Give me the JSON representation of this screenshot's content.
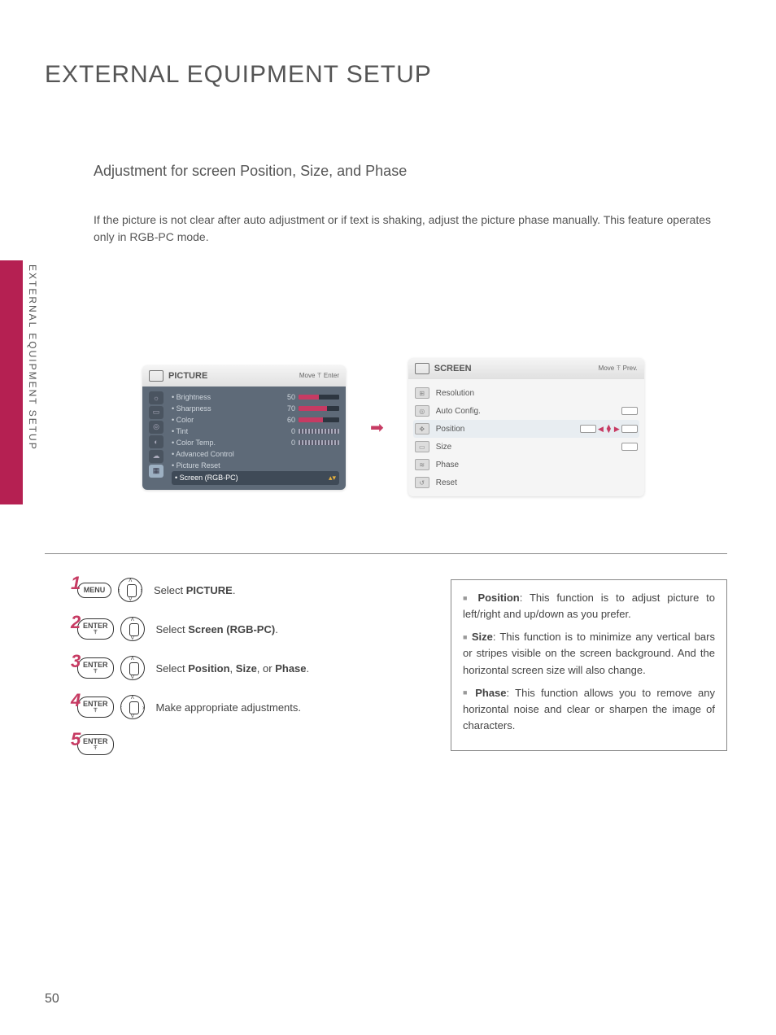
{
  "page": {
    "title": "EXTERNAL EQUIPMENT SETUP",
    "subtitle": "Adjustment for screen Position, Size, and Phase",
    "description": "If the picture is not clear after auto adjustment or if text is shaking, adjust the picture phase manually. This feature operates only in RGB-PC mode.",
    "side_label": "EXTERNAL EQUIPMENT SETUP",
    "page_number": "50"
  },
  "picture_panel": {
    "title": "PICTURE",
    "hints": "Move   ꔉ Enter",
    "items": [
      {
        "label": "• Brightness",
        "value": "50",
        "fill": 50,
        "type": "color"
      },
      {
        "label": "• Sharpness",
        "value": "70",
        "fill": 70,
        "type": "color"
      },
      {
        "label": "• Color",
        "value": "60",
        "fill": 60,
        "type": "color"
      },
      {
        "label": "• Tint",
        "value": "0",
        "fill": 50,
        "type": "grad"
      },
      {
        "label": "• Color Temp.",
        "value": "0",
        "fill": 50,
        "type": "grad"
      },
      {
        "label": "• Advanced Control",
        "value": "",
        "fill": 0,
        "type": "none"
      },
      {
        "label": "• Picture Reset",
        "value": "",
        "fill": 0,
        "type": "none"
      }
    ],
    "selected": "• Screen (RGB-PC)"
  },
  "screen_panel": {
    "title": "SCREEN",
    "hints": "Move   ꔉ Prev.",
    "items": [
      {
        "label": "Resolution",
        "selected": false,
        "control": "none"
      },
      {
        "label": "Auto Config.",
        "selected": false,
        "control": "box"
      },
      {
        "label": "Position",
        "selected": true,
        "control": "arrows"
      },
      {
        "label": "Size",
        "selected": false,
        "control": "box"
      },
      {
        "label": "Phase",
        "selected": false,
        "control": "none"
      },
      {
        "label": "Reset",
        "selected": false,
        "control": "none"
      }
    ]
  },
  "steps": [
    {
      "n": "1",
      "btn": "MENU",
      "nav": "full",
      "text_pre": "Select ",
      "text_bold": "PICTURE",
      "text_post": "."
    },
    {
      "n": "2",
      "btn": "ENTER",
      "nav": "ud",
      "text_pre": "Select ",
      "text_bold": "Screen (RGB-PC)",
      "text_post": "."
    },
    {
      "n": "3",
      "btn": "ENTER",
      "nav": "ud",
      "text_pre": "Select ",
      "text_bold": "Position",
      "text_mid": ", ",
      "text_bold2": "Size",
      "text_mid2": ", or ",
      "text_bold3": "Phase",
      "text_post": "."
    },
    {
      "n": "4",
      "btn": "ENTER",
      "nav": "full",
      "text_pre": "Make appropriate adjustments.",
      "text_bold": "",
      "text_post": ""
    },
    {
      "n": "5",
      "btn": "ENTER",
      "nav": "",
      "text_pre": "",
      "text_bold": "",
      "text_post": ""
    }
  ],
  "info": {
    "pos_label": "Position",
    "pos_text": ": This function is to adjust picture to left/right and up/down as you prefer.",
    "size_label": "Size",
    "size_text": ": This function is to minimize any vertical bars or stripes visible on the screen background. And the horizontal screen size will also change.",
    "phase_label": "Phase",
    "phase_text": ": This function allows you to remove any horizontal noise and clear or sharpen the image of characters."
  }
}
